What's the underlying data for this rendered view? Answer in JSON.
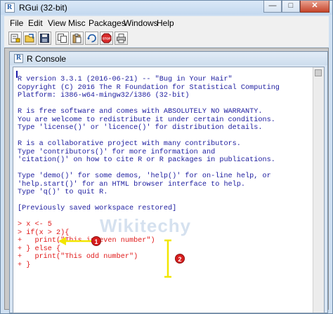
{
  "window": {
    "title": "RGui (32-bit)",
    "controls": {
      "minimize": "—",
      "maximize": "□",
      "close": "✕"
    }
  },
  "menubar": [
    "File",
    "Edit",
    "View",
    "Misc",
    "Packages",
    "Windows",
    "Help"
  ],
  "toolbar": {
    "buttons": [
      "open-script-icon",
      "load-workspace-icon",
      "save-workspace-icon",
      "copy-icon",
      "paste-icon",
      "copy-paste-icon",
      "stop-icon",
      "print-icon"
    ],
    "stop_label": "STOP"
  },
  "console": {
    "title": "R Console",
    "banner": [
      "R version 3.3.1 (2016-06-21) -- \"Bug in Your Hair\"",
      "Copyright (C) 2016 The R Foundation for Statistical Computing",
      "Platform: i386-w64-mingw32/i386 (32-bit)",
      "",
      "R is free software and comes with ABSOLUTELY NO WARRANTY.",
      "You are welcome to redistribute it under certain conditions.",
      "Type 'license()' or 'licence()' for distribution details.",
      "",
      "R is a collaborative project with many contributors.",
      "Type 'contributors()' for more information and",
      "'citation()' on how to cite R or R packages in publications.",
      "",
      "Type 'demo()' for some demos, 'help()' for on-line help, or",
      "'help.start()' for an HTML browser interface to help.",
      "Type 'q()' to quit R.",
      "",
      "[Previously saved workspace restored]",
      ""
    ],
    "commands": [
      "> x <- 5",
      "> if(x > 2){",
      "+   print(\"This is even number\")",
      "+ } else {",
      "+   print(\"This odd number\")",
      "+ }"
    ]
  },
  "watermark": "Wikitechy",
  "annotations": {
    "callout_1": "1",
    "callout_2": "2",
    "callout_color": "#d81e1e",
    "arrow_color": "#f2e600"
  }
}
